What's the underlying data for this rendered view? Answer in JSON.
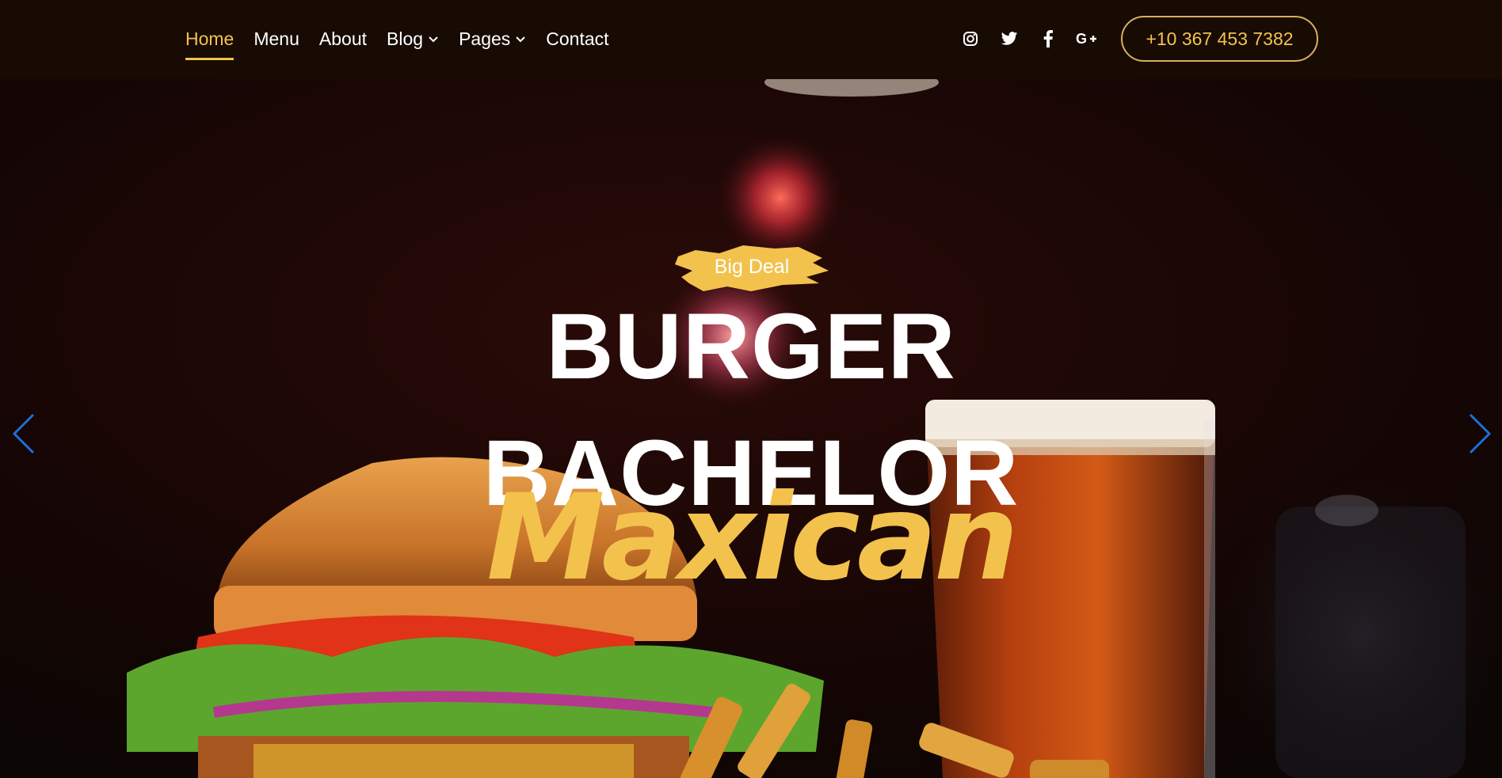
{
  "nav": {
    "links": [
      {
        "label": "Home",
        "active": true
      },
      {
        "label": "Menu"
      },
      {
        "label": "About"
      },
      {
        "label": "Blog",
        "dropdown": true
      },
      {
        "label": "Pages",
        "dropdown": true
      },
      {
        "label": "Contact"
      }
    ],
    "social_icons": [
      "instagram-icon",
      "twitter-icon",
      "facebook-icon",
      "google-plus-icon"
    ],
    "phone": "+10 367 453 7382"
  },
  "hero": {
    "badge": "Big Deal",
    "title_line1": "BURGER",
    "title_line2": "BACHELOR",
    "script_text": "Maxican",
    "prev_icon": "chevron-left-icon",
    "next_icon": "chevron-right-icon"
  },
  "colors": {
    "accent": "#f5c24c",
    "navbar_bg": "#170b04",
    "text": "#ffffff",
    "slider_arrow": "#1d6fd6"
  }
}
